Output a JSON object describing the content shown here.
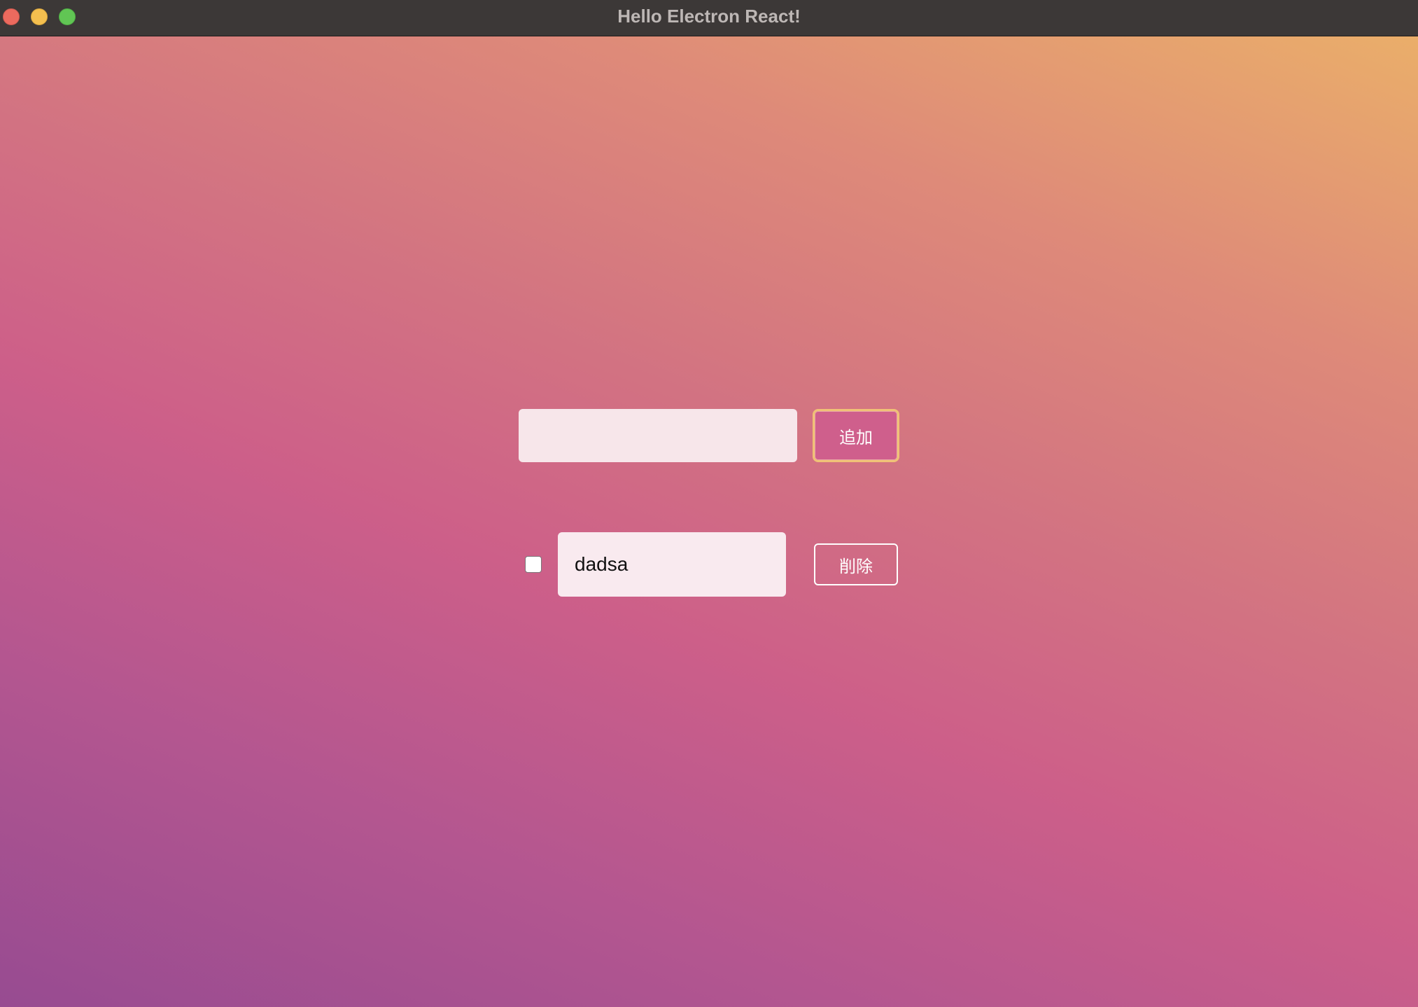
{
  "window": {
    "title": "Hello Electron React!",
    "controls": {
      "close": "close-button",
      "minimize": "minimize-button",
      "zoom": "zoom-button"
    }
  },
  "colors": {
    "titlebar": "#3c3837",
    "gradient_start": "#974b91",
    "gradient_mid": "#cd5f89",
    "gradient_end": "#eaae6a",
    "add_button_bg": "#cf5f8c",
    "add_button_focus_ring": "#f0c176"
  },
  "new_todo": {
    "value": "",
    "add_label": "追加"
  },
  "todos": [
    {
      "checked": false,
      "text": "dadsa",
      "delete_label": "削除"
    }
  ]
}
